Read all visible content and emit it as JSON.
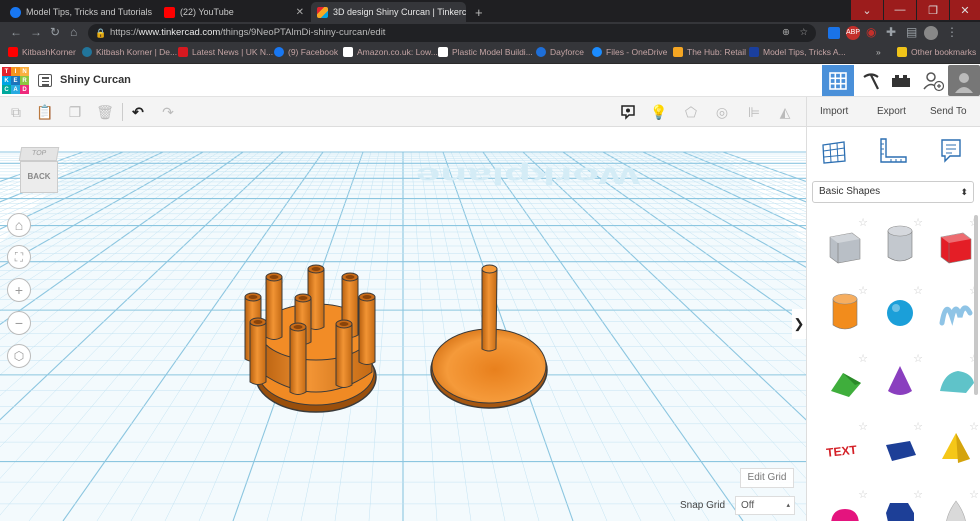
{
  "browser": {
    "tabs": [
      {
        "label": "Model Tips, Tricks and Tutorials",
        "icon": "facebook-icon",
        "color": "#1877f2",
        "active": false
      },
      {
        "label": "(22) YouTube",
        "icon": "youtube-icon",
        "color": "#ff0000",
        "active": false
      },
      {
        "label": "3D design Shiny Curcan | Tinkercad",
        "icon": "tinkercad-icon",
        "color": "#f7a823",
        "active": true
      }
    ],
    "new_tab": "+",
    "url_host": "www.tinkercad.com",
    "url_prefix": "https://",
    "url_path": "/things/9NeoPTAlmDi-shiny-curcan/edit",
    "bookmarks": [
      {
        "label": "KitbashKorner",
        "icon": "youtube-icon",
        "color": "#ff0000"
      },
      {
        "label": "Kitbash Korner | De...",
        "icon": "wordpress-icon",
        "color": "#21759b"
      },
      {
        "label": "Latest News | UK N...",
        "icon": "news-icon",
        "color": "#d71920"
      },
      {
        "label": "(9) Facebook",
        "icon": "facebook-icon",
        "color": "#1877f2"
      },
      {
        "label": "Amazon.co.uk: Low...",
        "icon": "amazon-icon",
        "color": "#ffffff"
      },
      {
        "label": "Plastic Model Buildi...",
        "icon": "wix-icon",
        "color": "#ffffff"
      },
      {
        "label": "Dayforce",
        "icon": "dayforce-icon",
        "color": "#1e6fd9"
      },
      {
        "label": "Files - OneDrive",
        "icon": "onedrive-icon",
        "color": "#1b8cff"
      },
      {
        "label": "The Hub: Retail",
        "icon": "hub-icon",
        "color": "#f5a623"
      },
      {
        "label": "Model Tips, Tricks A...",
        "icon": "yc-icon",
        "color": "#1a3f9e"
      }
    ],
    "other_bookmarks": "Other bookmarks",
    "more_bookmarks": "»"
  },
  "header": {
    "logo_letters": [
      "T",
      "I",
      "N",
      "K",
      "E",
      "R",
      "C",
      "A",
      "D"
    ],
    "logo_colors": [
      "#e2252d",
      "#f7941d",
      "#fbb040",
      "#00a4e4",
      "#1c75bc",
      "#8dc63f",
      "#00a99d",
      "#27aae1",
      "#ee2a7b"
    ],
    "design_title": "Shiny Curcan"
  },
  "toolbar": {
    "import_label": "Import",
    "export_label": "Export",
    "send_to_label": "Send To"
  },
  "viewcube": {
    "top_label": "TOP",
    "back_label": "BACK"
  },
  "workplane": {
    "watermark": "Workplane",
    "edit_grid_label": "Edit Grid",
    "snap_grid_label": "Snap Grid",
    "snap_grid_value": "Off"
  },
  "shapes_panel": {
    "category": "Basic Shapes",
    "collapse_arrow": "❯",
    "shapes": [
      {
        "name": "box-hole",
        "color": "#b9bfc6"
      },
      {
        "name": "cylinder-hole",
        "color": "#c3c8ce"
      },
      {
        "name": "box",
        "color": "#e41e26"
      },
      {
        "name": "cylinder",
        "color": "#f28c1c"
      },
      {
        "name": "sphere",
        "color": "#1b9fd9"
      },
      {
        "name": "scribble",
        "color": "#8fc4e6"
      },
      {
        "name": "roof",
        "color": "#3fae3c"
      },
      {
        "name": "cone",
        "color": "#8a3fbf"
      },
      {
        "name": "round-roof",
        "color": "#5fc3c9"
      },
      {
        "name": "text",
        "color": "#d42027"
      },
      {
        "name": "wedge",
        "color": "#1d3f97"
      },
      {
        "name": "pyramid",
        "color": "#f5c718"
      },
      {
        "name": "half-sphere",
        "color": "#e4147e"
      },
      {
        "name": "polygon",
        "color": "#1d3f97"
      },
      {
        "name": "paraboloid",
        "color": "#d9d9d9"
      }
    ],
    "text_shape_label": "TEXT"
  },
  "colors": {
    "accent": "#4a90d9",
    "orange_part": "#f08a24",
    "grid": "#a9d6ec"
  }
}
